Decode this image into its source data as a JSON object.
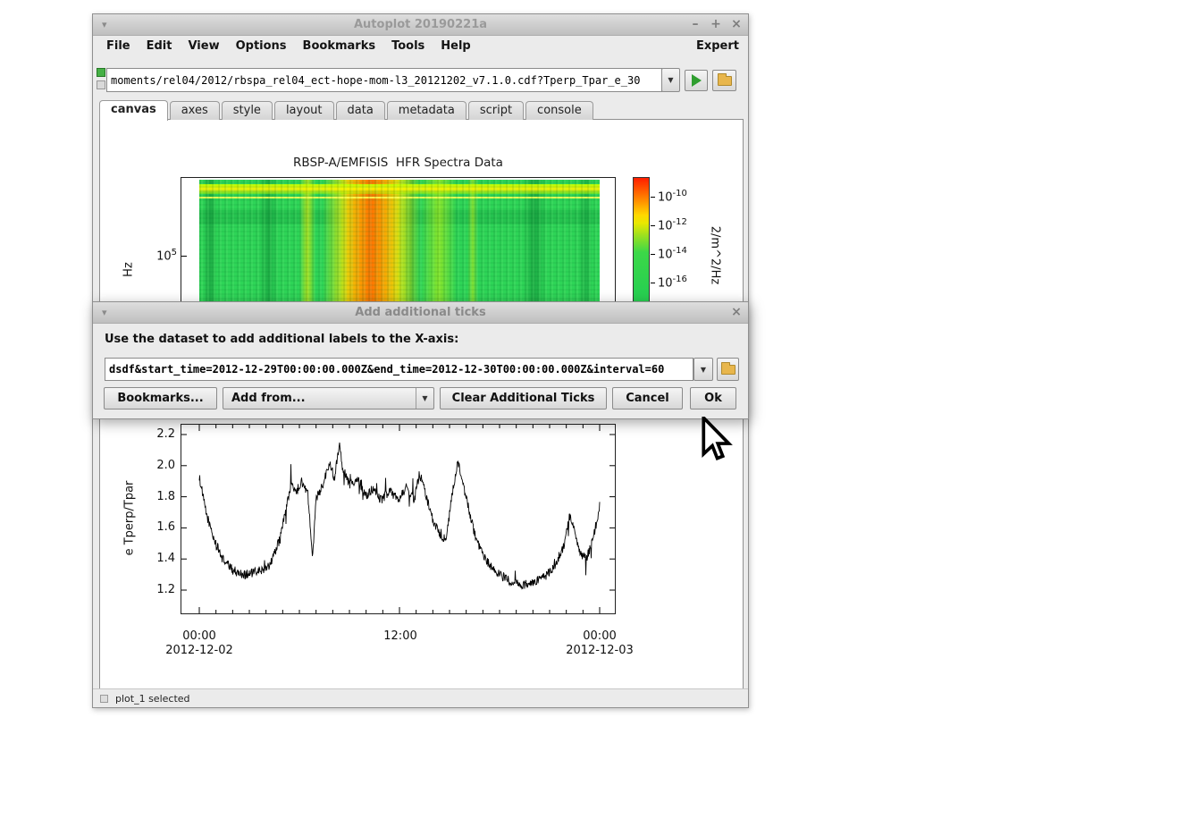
{
  "window": {
    "title": "Autoplot 20190221a",
    "shade_icon": "▾",
    "minimize": "–",
    "maximize": "+",
    "close": "×"
  },
  "menubar": {
    "items": [
      "File",
      "Edit",
      "View",
      "Options",
      "Bookmarks",
      "Tools",
      "Help"
    ],
    "expert": "Expert"
  },
  "toolbar": {
    "uri_value": "moments/rel04/2012/rbspa_rel04_ect-hope-mom-l3_20121202_v7.1.0.cdf?Tperp_Tpar_e_30",
    "combo_arrow": "▼"
  },
  "tabs": {
    "items": [
      "canvas",
      "axes",
      "style",
      "layout",
      "data",
      "metadata",
      "script",
      "console"
    ],
    "active": "canvas"
  },
  "spectra_plot": {
    "title": "RBSP-A/EMFISIS  HFR Spectra Data",
    "ylabel": "Hz",
    "ytick": {
      "base": "10",
      "exp": "5"
    },
    "colorbar": {
      "ticks": [
        {
          "base": "10",
          "exp": "-10"
        },
        {
          "base": "10",
          "exp": "-12"
        },
        {
          "base": "10",
          "exp": "-14"
        },
        {
          "base": "10",
          "exp": "-16"
        }
      ],
      "unit_label": "2/m^2/Hz"
    }
  },
  "dialog": {
    "title": "Add additional ticks",
    "shade_icon": "▾",
    "close": "×",
    "message": "Use the dataset to add additional labels to the X-axis:",
    "uri_value": "dsdf&start_time=2012-12-29T00:00:00.000Z&end_time=2012-12-30T00:00:00.000Z&interval=60",
    "combo_arrow": "▼",
    "buttons": {
      "bookmarks": "Bookmarks...",
      "add_from": "Add from...",
      "clear": "Clear Additional Ticks",
      "cancel": "Cancel",
      "ok": "Ok"
    }
  },
  "line_plot": {
    "ylabel": "e Tperp/Tpar",
    "yticks": [
      "2.2",
      "2.0",
      "1.8",
      "1.6",
      "1.4",
      "1.2"
    ],
    "xticks": [
      {
        "time": "00:00",
        "date": "2012-12-02"
      },
      {
        "time": "12:00",
        "date": ""
      },
      {
        "time": "00:00",
        "date": "2012-12-03"
      }
    ]
  },
  "statusbar": {
    "text": "plot_1 selected"
  },
  "colors": {
    "play_green": "#2f9e2f",
    "folder_yellow": "#e8b64c",
    "spectro_green": "#2ed457",
    "spectro_yellow": "#ffe600",
    "spectro_orange": "#ff8c00",
    "colorbar_red": "#ff1e00"
  },
  "chart_data": [
    {
      "type": "heatmap",
      "title": "RBSP-A/EMFISIS  HFR Spectra Data",
      "ylabel": "Hz",
      "yticks": [
        "1e5"
      ],
      "colorbar_ticks": [
        "1e-10",
        "1e-12",
        "1e-14",
        "1e-16"
      ],
      "colorbar_unit": "2/m^2/Hz",
      "description": "Green spectrogram with a bright yellow horizontal band near the top, an intense yellow-orange vertical burst region near 40-45% of the time range, and several darker green vertical bands."
    },
    {
      "type": "line",
      "ylabel": "e Tperp/Tpar",
      "ylim": [
        1.1,
        2.3
      ],
      "x_hours_range": [
        0,
        24
      ],
      "xlabel_ticks": [
        "2012-12-02 00:00",
        "12:00",
        "2012-12-03 00:00"
      ],
      "anchors": [
        [
          0,
          1.93
        ],
        [
          0.4,
          1.7
        ],
        [
          0.9,
          1.52
        ],
        [
          1.4,
          1.4
        ],
        [
          2,
          1.33
        ],
        [
          2.6,
          1.3
        ],
        [
          3.2,
          1.31
        ],
        [
          3.8,
          1.33
        ],
        [
          4.3,
          1.38
        ],
        [
          4.8,
          1.52
        ],
        [
          5.2,
          1.72
        ],
        [
          5.5,
          1.88
        ],
        [
          5.8,
          1.82
        ],
        [
          6.1,
          1.9
        ],
        [
          6.5,
          1.83
        ],
        [
          6.8,
          1.42
        ],
        [
          7,
          1.78
        ],
        [
          7.4,
          1.88
        ],
        [
          7.8,
          2.02
        ],
        [
          8.1,
          1.92
        ],
        [
          8.4,
          2.15
        ],
        [
          8.6,
          1.98
        ],
        [
          9,
          1.88
        ],
        [
          9.5,
          1.92
        ],
        [
          10,
          1.8
        ],
        [
          10.4,
          1.85
        ],
        [
          10.9,
          1.78
        ],
        [
          11.4,
          1.84
        ],
        [
          11.9,
          1.78
        ],
        [
          12.4,
          1.86
        ],
        [
          12.9,
          1.78
        ],
        [
          13.2,
          1.95
        ],
        [
          13.5,
          1.85
        ],
        [
          13.9,
          1.68
        ],
        [
          14.3,
          1.58
        ],
        [
          14.8,
          1.52
        ],
        [
          15.2,
          1.85
        ],
        [
          15.5,
          2.02
        ],
        [
          15.8,
          1.88
        ],
        [
          16.2,
          1.7
        ],
        [
          16.6,
          1.52
        ],
        [
          17,
          1.42
        ],
        [
          17.5,
          1.35
        ],
        [
          18,
          1.3
        ],
        [
          18.6,
          1.26
        ],
        [
          19.3,
          1.23
        ],
        [
          20,
          1.25
        ],
        [
          20.7,
          1.28
        ],
        [
          21.3,
          1.35
        ],
        [
          21.9,
          1.5
        ],
        [
          22.2,
          1.68
        ],
        [
          22.5,
          1.58
        ],
        [
          22.8,
          1.44
        ],
        [
          23.2,
          1.4
        ],
        [
          23.6,
          1.52
        ],
        [
          24,
          1.74
        ]
      ]
    }
  ]
}
